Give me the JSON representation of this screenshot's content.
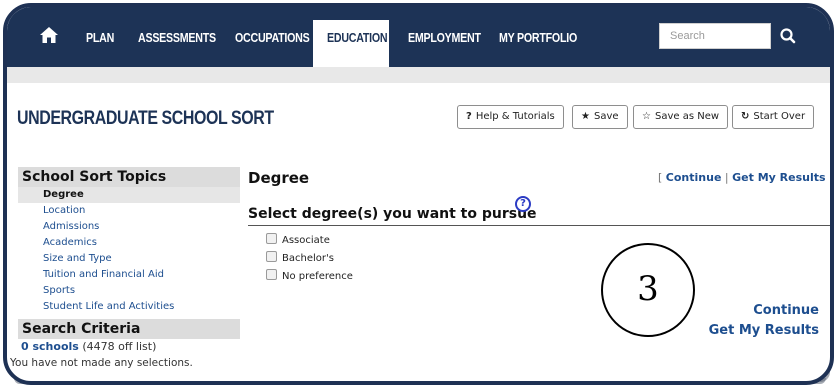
{
  "nav": {
    "items": [
      "PLAN",
      "ASSESSMENTS",
      "OCCUPATIONS",
      "EDUCATION",
      "EMPLOYMENT",
      "MY PORTFOLIO"
    ],
    "active": "EDUCATION",
    "search_placeholder": "Search"
  },
  "page": {
    "title": "UNDERGRADUATE SCHOOL SORT"
  },
  "toolbar": {
    "help_label": "Help & Tutorials",
    "help_icon": "?",
    "save_label": "Save",
    "save_as_new_label": "Save as New",
    "start_over_label": "Start Over"
  },
  "sidebar": {
    "topics_header": "School Sort Topics",
    "items": [
      "Degree",
      "Location",
      "Admissions",
      "Academics",
      "Size and Type",
      "Tuition and Financial Aid",
      "Sports",
      "Student Life and Activities"
    ],
    "current": "Degree",
    "criteria_header": "Search Criteria",
    "schools_count": "0 schools",
    "off_list": "(4478 off list)",
    "no_selection": "You have not made any selections."
  },
  "main": {
    "section_title": "Degree",
    "link_open": "[",
    "link_continue": "Continue",
    "link_sep": "|",
    "link_results": "Get My Results",
    "link_close": "]",
    "question": "Select degree(s) you want to pursue",
    "help_icon": "?",
    "options": [
      "Associate",
      "Bachelor's",
      "No preference"
    ],
    "callout_number": "3",
    "bottom_continue": "Continue",
    "bottom_results": "Get My Results"
  },
  "colors": {
    "nav_bg": "#1d3356",
    "link": "#1d4e8f",
    "frame": "#1e3154"
  }
}
